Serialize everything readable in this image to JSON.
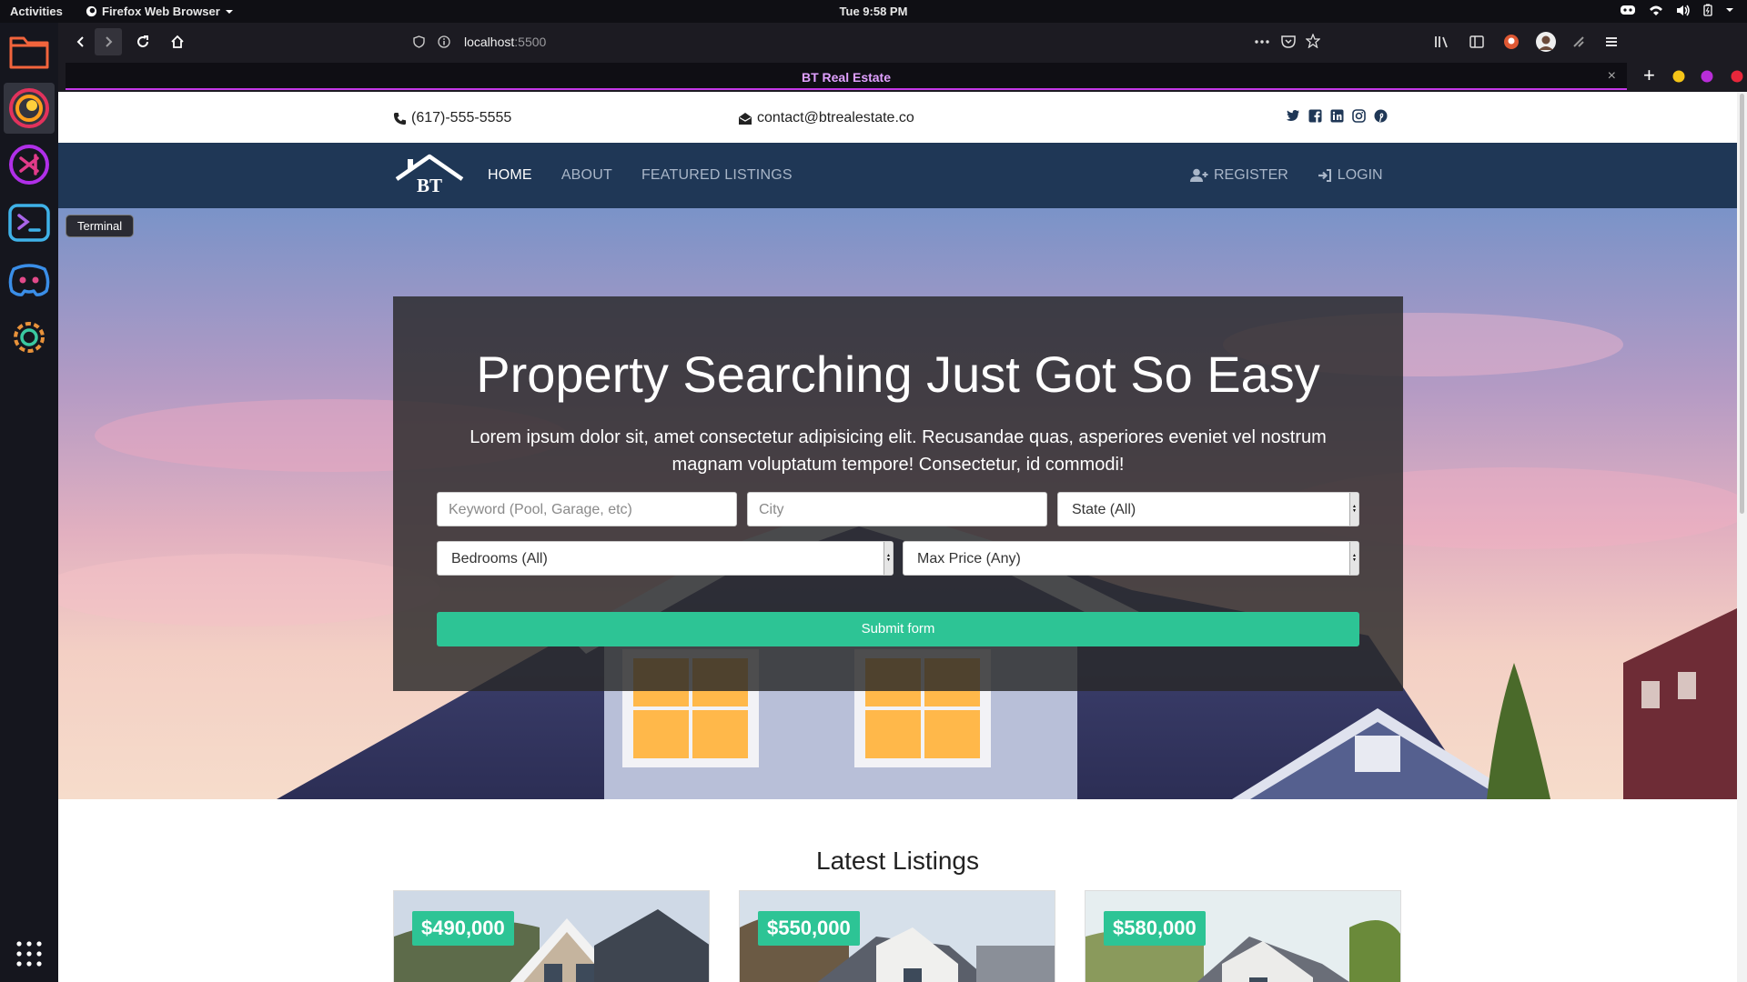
{
  "desktop": {
    "activities": "Activities",
    "app_name": "Firefox Web Browser",
    "clock": "Tue  9:58 PM",
    "dock_tooltip": "Terminal",
    "dock_items": [
      "files-icon",
      "firefox-icon",
      "vscode-icon",
      "terminal-icon",
      "discord-icon",
      "settings-icon",
      "app-grid-icon"
    ]
  },
  "browser": {
    "url_host": "localhost",
    "url_port": ":5500",
    "tab_title": "BT Real Estate",
    "tab_close": "×",
    "new_tab": "+"
  },
  "site": {
    "phone": "(617)-555-5555",
    "email": "contact@btrealestate.co",
    "logo_text": "BT",
    "nav": {
      "home": "HOME",
      "about": "ABOUT",
      "featured": "FEATURED LISTINGS",
      "register": "REGISTER",
      "login": "LOGIN"
    },
    "social_icons": [
      "twitter-icon",
      "facebook-icon",
      "linkedin-icon",
      "instagram-icon",
      "pinterest-icon"
    ],
    "hero": {
      "heading": "Property Searching Just Got So Easy",
      "lead": "Lorem ipsum dolor sit, amet consectetur adipisicing elit. Recusandae quas, asperiores eveniet vel nostrum magnam voluptatum tempore! Consectetur, id commodi!",
      "keyword_placeholder": "Keyword (Pool, Garage, etc)",
      "city_placeholder": "City",
      "state_selected": "State (All)",
      "bedrooms_selected": "Bedrooms (All)",
      "price_selected": "Max Price (Any)",
      "submit_label": "Submit form"
    },
    "latest_title": "Latest Listings",
    "listings": [
      {
        "price": "$490,000"
      },
      {
        "price": "$550,000"
      },
      {
        "price": "$580,000"
      }
    ]
  },
  "colors": {
    "accent": "#2dc495",
    "nav_bg": "#1f3756",
    "tab_underline": "#c538e8"
  }
}
